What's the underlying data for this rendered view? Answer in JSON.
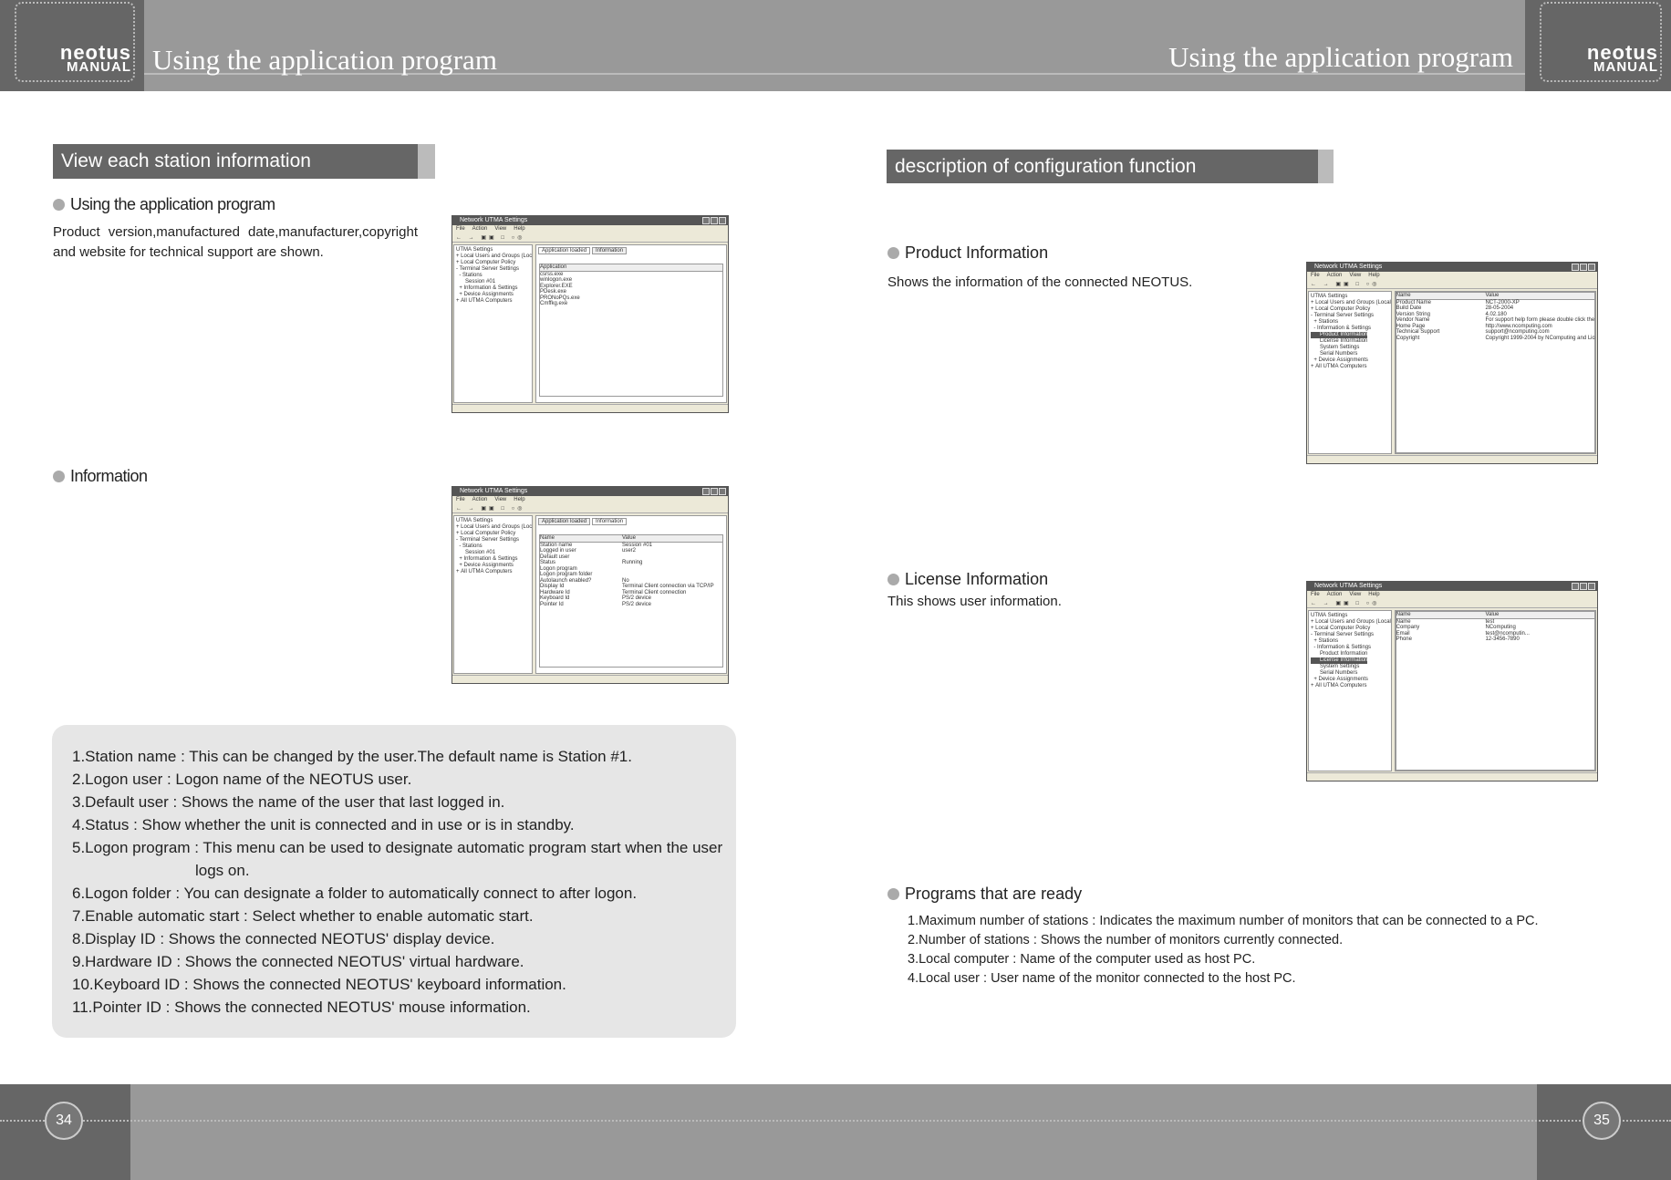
{
  "header": {
    "left_title": "Using the application program",
    "right_title": "Using the application program",
    "logo_text": "neotus",
    "logo_subtext": "MANUAL"
  },
  "footer": {
    "left_page": "34",
    "right_page": "35"
  },
  "left": {
    "section_title": "View each station information",
    "bullet1": "Using the application program",
    "paragraph1": "Product version,manufactured date,manufacturer,copyright and website for technical support are shown.",
    "bullet2": "Information",
    "notes": [
      "1.Station name : This can be changed by the user.The default name is Station #1.",
      "2.Logon user : Logon name of the NEOTUS user.",
      "3.Default user : Shows the name of the user that last logged in.",
      "4.Status : Show whether the unit is connected and in use or is in standby.",
      "5.Logon program : This menu can be used to designate automatic program start when the user",
      "logs on.",
      "6.Logon folder : You can designate a folder to automatically connect to after logon.",
      "7.Enable automatic start : Select whether to enable automatic start.",
      "8.Display ID : Shows the connected NEOTUS' display device.",
      "9.Hardware ID : Shows the connected NEOTUS' virtual hardware.",
      "10.Keyboard ID : Shows the connected NEOTUS' keyboard information.",
      "11.Pointer ID : Shows the connected NEOTUS' mouse information."
    ]
  },
  "right": {
    "section_title": "description of configuration function",
    "bullet1": "Product Information",
    "text1": "Shows the information of the connected NEOTUS.",
    "bullet2": "License Information",
    "text2": "This shows user information.",
    "bullet3": "Programs that are ready",
    "programs": [
      "1.Maximum number of stations : Indicates the maximum number of monitors that can be connected to a PC.",
      "2.Number of stations : Shows the number of monitors currently connected.",
      "3.Local computer : Name of the computer used as host PC.",
      "4.Local user : User name of the monitor connected to the host PC."
    ]
  },
  "windows": [
    {
      "title": "Network UTMA Settings",
      "menu": [
        "File",
        "Action",
        "View",
        "Help"
      ],
      "tree": [
        "UTMA Settings",
        "+ Local Users and Groups (Local)",
        "+ Local Computer Policy",
        "- Terminal Server Settings",
        "  - Stations",
        "      Session #01",
        "  + Information & Settings",
        "  + Device Assignments",
        "+ All UTMA Computers"
      ],
      "selected": -1,
      "tabs": [
        "Application loaded",
        "Information"
      ],
      "active_tab": 0,
      "columns": [
        "Application"
      ],
      "rows": [
        [
          "csrss.exe"
        ],
        [
          "winlogon.exe"
        ],
        [
          "Explorer.EXE"
        ],
        [
          "PDesk.exe"
        ],
        [
          "PRONoPQs.exe"
        ],
        [
          "Cmffkg.exe"
        ]
      ]
    },
    {
      "title": "Network UTMA Settings",
      "menu": [
        "File",
        "Action",
        "View",
        "Help"
      ],
      "tree": [
        "UTMA Settings",
        "+ Local Users and Groups (Local)",
        "+ Local Computer Policy",
        "- Terminal Server Settings",
        "  - Stations",
        "      Session #01",
        "  + Information & Settings",
        "  + Device Assignments",
        "+ All UTMA Computers"
      ],
      "selected": -1,
      "tabs": [
        "Application loaded",
        "Information"
      ],
      "active_tab": 1,
      "columns": [
        "Name",
        "Value"
      ],
      "rows": [
        [
          "Station name",
          "Session #01"
        ],
        [
          "Logged in user",
          "user2"
        ],
        [
          "Default user",
          ""
        ],
        [
          "Status",
          "Running"
        ],
        [
          "Logon program",
          ""
        ],
        [
          "Logon program folder",
          ""
        ],
        [
          "Autolaunch enabled?",
          "No"
        ],
        [
          "Display Id",
          "Terminal Client connection via TCP/IP"
        ],
        [
          "Hardware Id",
          "Terminal Client connection"
        ],
        [
          "Keyboard Id",
          "PS/2 device"
        ],
        [
          "Pointer Id",
          "PS/2 device"
        ]
      ]
    },
    {
      "title": "Network UTMA Settings",
      "menu": [
        "File",
        "Action",
        "View",
        "Help"
      ],
      "tree": [
        "UTMA Settings",
        "+ Local Users and Groups (Local)",
        "+ Local Computer Policy",
        "- Terminal Server Settings",
        "  + Stations",
        "  - Information & Settings",
        "      Product Information",
        "      License Information",
        "      System Settings",
        "      Serial Numbers",
        "  + Device Assignments",
        "+ All UTMA Computers"
      ],
      "selected": 6,
      "tabs": [],
      "active_tab": -1,
      "columns": [
        "Name",
        "Value"
      ],
      "rows": [
        [
          "Product Name",
          "NCT-2000-XP"
        ],
        [
          "Build Date",
          "28-05-2004"
        ],
        [
          "Version String",
          "4.02.180"
        ],
        [
          "Vendor Name",
          "For support help form please double click the below links"
        ],
        [
          "Home Page",
          "http://www.ncomputing.com"
        ],
        [
          "Technical Support",
          "support@ncomputing.com"
        ],
        [
          "Copyright",
          "Copyright 1999-2004 by NComputing and Licensors"
        ]
      ]
    },
    {
      "title": "Network UTMA Settings",
      "menu": [
        "File",
        "Action",
        "View",
        "Help"
      ],
      "tree": [
        "UTMA Settings",
        "+ Local Users and Groups (Local)",
        "+ Local Computer Policy",
        "- Terminal Server Settings",
        "  + Stations",
        "  - Information & Settings",
        "      Product Information",
        "      License Information",
        "      System Settings",
        "      Serial Numbers",
        "  + Device Assignments",
        "+ All UTMA Computers"
      ],
      "selected": 7,
      "tabs": [],
      "active_tab": -1,
      "columns": [
        "Name",
        "Value"
      ],
      "rows": [
        [
          "Name",
          "test"
        ],
        [
          "Company",
          "NComputing"
        ],
        [
          "Email",
          "test@ncomputin..."
        ],
        [
          "Phone",
          "12-3456-7890"
        ]
      ]
    }
  ]
}
